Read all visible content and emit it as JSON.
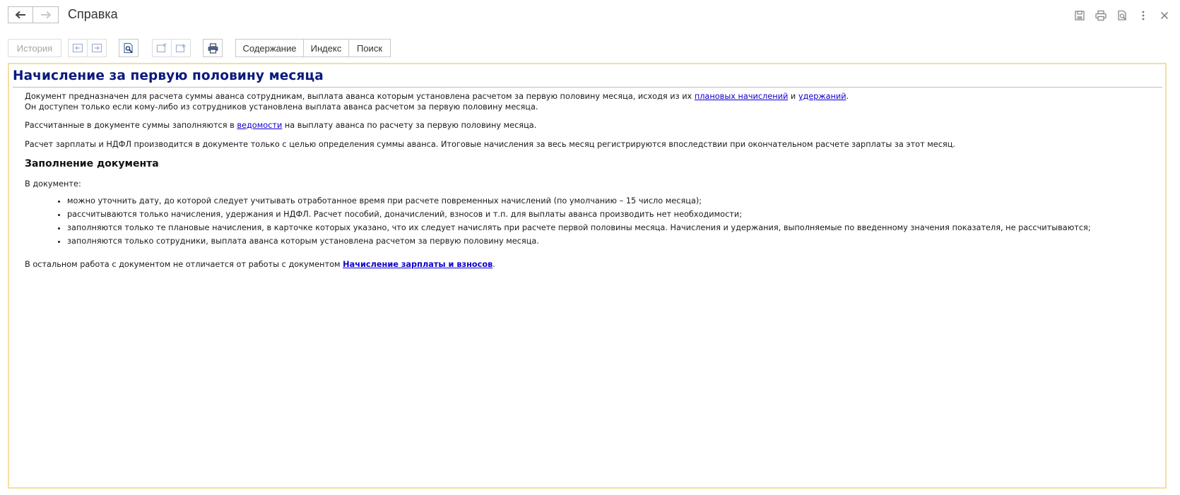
{
  "window": {
    "title": "Справка",
    "tools": [
      "save-icon",
      "print-icon",
      "preview-icon",
      "more-icon",
      "close-icon"
    ]
  },
  "toolbar": {
    "history_label": "История",
    "tabs": [
      "Содержание",
      "Индекс",
      "Поиск"
    ]
  },
  "document": {
    "title": "Начисление за первую половину месяца",
    "p1_text_a": "Документ предназначен для расчета суммы аванса сотрудникам, выплата аванса которым установлена расчетом за первую половину месяца, исходя из их ",
    "p1_link1": "плановых начислений",
    "p1_text_b": " и ",
    "p1_link2": "удержаний",
    "p1_text_c": ".",
    "p1_line2": "Он доступен только если кому-либо из сотрудников установлена выплата аванса расчетом за первую половину месяца.",
    "p2_text_a": "Рассчитанные в документе суммы заполняются в ",
    "p2_link": "ведомости",
    "p2_text_b": " на выплату аванса по расчету за первую половину месяца.",
    "p3": "Расчет зарплаты и НДФЛ производится в документе только с целью определения суммы аванса. Итоговые начисления за весь месяц регистрируются впоследствии при окончательном расчете зарплаты за этот месяц.",
    "subheading": "Заполнение документа",
    "p4": "В документе:",
    "list": [
      "можно уточнить дату, до которой следует учитывать отработанное время при расчете повременных начислений (по умолчанию – 15 число месяца);",
      "рассчитываются только начисления, удержания и НДФЛ. Расчет пособий, доначислений, взносов и т.п. для выплаты аванса производить нет необходимости;",
      "заполняются только те плановые начисления, в карточке которых указано, что их следует начислять при расчете первой половины месяца. Начисления и удержания, выполняемые по введенному значения показателя, не рассчитываются;",
      "заполняются только сотрудники, выплата аванса которым установлена расчетом за первую половину месяца."
    ],
    "p5_text_a": "В остальном работа с документом не отличается от работы с документом ",
    "p5_link": "Начисление зарплаты и взносов",
    "p5_text_b": "."
  }
}
